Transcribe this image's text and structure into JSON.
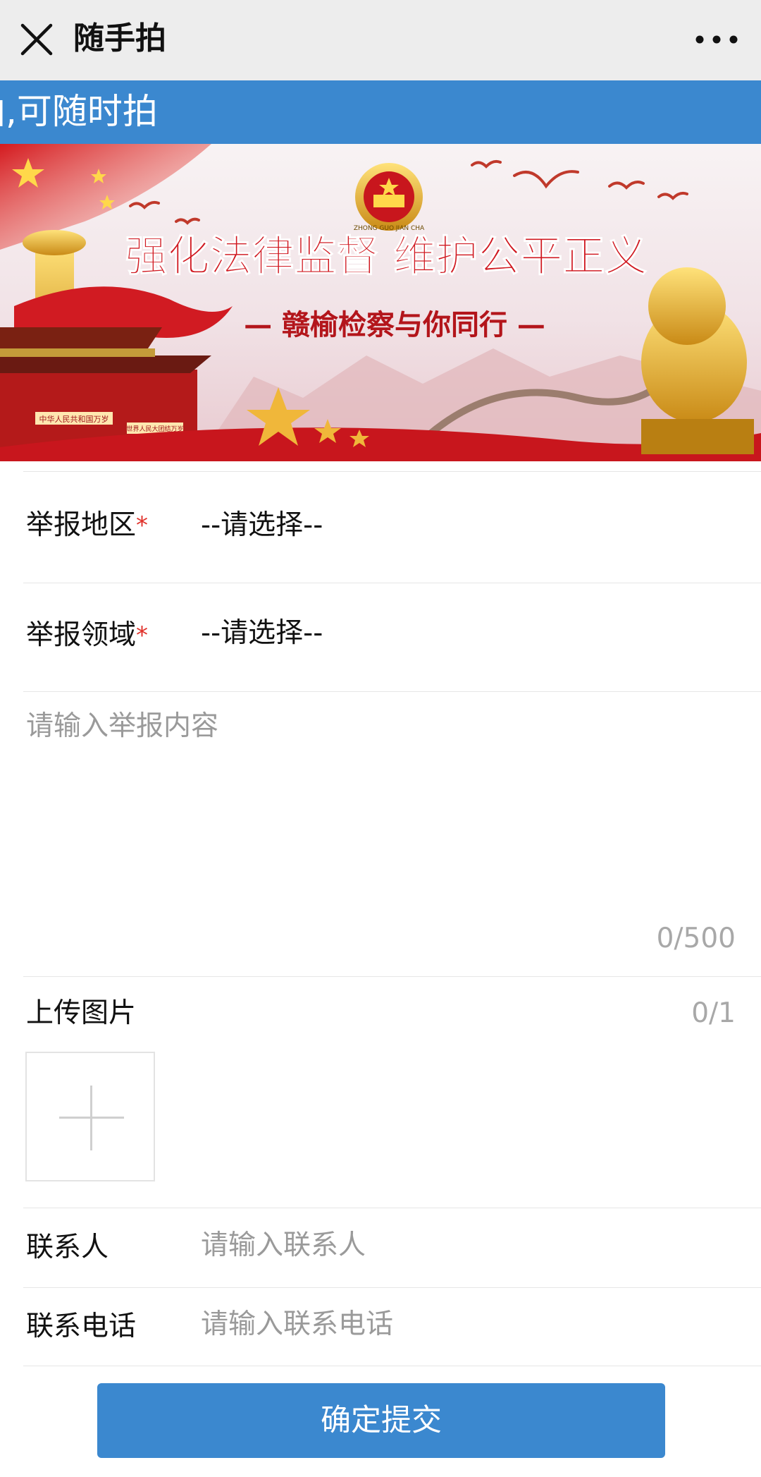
{
  "nav": {
    "title": "随手拍"
  },
  "marquee": {
    "text": "拍,可随时拍"
  },
  "banner": {
    "headline": "强化法律监督 维护公平正义",
    "subline": "— 赣榆检察与你同行 —",
    "emblem_text": "ZHONG GUO JIAN CHA",
    "gate_sign_left": "中华人民共和国万岁",
    "gate_sign_right": "世界人民大团结万岁"
  },
  "form": {
    "region": {
      "label": "举报地区",
      "required_mark": "*",
      "value": "--请选择--"
    },
    "field": {
      "label": "举报领域",
      "required_mark": "*",
      "value": "--请选择--"
    },
    "content": {
      "placeholder": "请输入举报内容",
      "counter": "0/500"
    },
    "upload": {
      "label": "上传图片",
      "counter": "0/1"
    },
    "contact": {
      "label": "联系人",
      "placeholder": "请输入联系人"
    },
    "phone": {
      "label": "联系电话",
      "placeholder": "请输入联系电话"
    }
  },
  "submit": {
    "label": "确定提交"
  },
  "colors": {
    "accent": "#3b88cf",
    "required": "#e0322b",
    "banner_red": "#c8161d",
    "gold": "#e9b33a"
  }
}
